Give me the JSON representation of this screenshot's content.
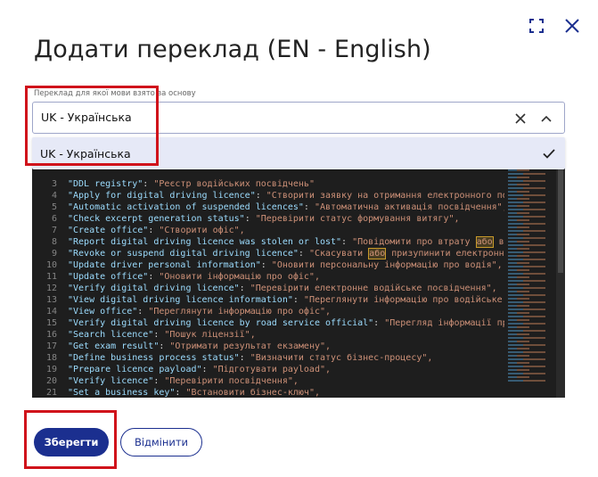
{
  "dialog": {
    "title": "Додати переклад (EN - English)"
  },
  "source_field": {
    "label": "Переклад для якої мови взято за основу",
    "value": "UK - Українська",
    "options": [
      {
        "label": "UK - Українська",
        "selected": true
      }
    ]
  },
  "editor": {
    "lines": [
      {
        "n": "3",
        "key": "\"DDL registry\"",
        "val": "\"Реєстр водійських посвідчень\"",
        "hl": false
      },
      {
        "n": "4",
        "key": "\"Apply for digital driving licence\"",
        "val": "\"Створити заявку на отримання електронного посві",
        "hl": false
      },
      {
        "n": "5",
        "key": "\"Automatic activation of suspended licences\"",
        "val": "\"Автоматична активація посвідчення\",",
        "hl": false
      },
      {
        "n": "6",
        "key": "\"Check excerpt generation status\"",
        "val": "\"Перевірити статус формування витягу\",",
        "hl": false
      },
      {
        "n": "7",
        "key": "\"Create office\"",
        "val": "\"Створити офіс\",",
        "hl": false
      },
      {
        "n": "8",
        "key": "\"Report digital driving licence was stolen or lost\"",
        "val_pre": "\"Повідомити про втрату ",
        "val_hl": "або",
        "val_post": " викра",
        "hl": true
      },
      {
        "n": "9",
        "key": "\"Revoke or suspend digital driving licence\"",
        "val_pre": "\"Скасувати ",
        "val_hl": "або",
        "val_post": " призупинити електронне вод",
        "hl": true
      },
      {
        "n": "10",
        "key": "\"Update driver personal information\"",
        "val": "\"Оновити персональну інформацію про водія\",",
        "hl": false
      },
      {
        "n": "11",
        "key": "\"Update office\"",
        "val": "\"Оновити інформацію про офіс\",",
        "hl": false
      },
      {
        "n": "12",
        "key": "\"Verify digital driving licence\"",
        "val": "\"Перевірити електронне водійське посвідчення\",",
        "hl": false
      },
      {
        "n": "13",
        "key": "\"View digital driving licence information\"",
        "val": "\"Переглянути інформацію про водійське посв",
        "hl": false
      },
      {
        "n": "14",
        "key": "\"View office\"",
        "val": "\"Переглянути інформацію про офіс\",",
        "hl": false
      },
      {
        "n": "15",
        "key": "\"Verify digital driving licence by road service official\"",
        "val": "\"Перегляд інформації про в",
        "hl": false
      },
      {
        "n": "16",
        "key": "\"Search licence\"",
        "val": "\"Пошук ліцензії\",",
        "hl": false
      },
      {
        "n": "17",
        "key": "\"Get exam result\"",
        "val": "\"Отримати результат екзамену\",",
        "hl": false
      },
      {
        "n": "18",
        "key": "\"Define business process status\"",
        "val": "\"Визначити статус бізнес-процесу\",",
        "hl": false
      },
      {
        "n": "19",
        "key": "\"Prepare licence payload\"",
        "val": "\"Підготувати payload\",",
        "hl": false
      },
      {
        "n": "20",
        "key": "\"Verify licence\"",
        "val": "\"Перевірити посвідчення\",",
        "hl": false
      },
      {
        "n": "21",
        "key": "\"Set a business key\"",
        "val": "\"Встановити бізнес-ключ\",",
        "hl": false
      }
    ]
  },
  "buttons": {
    "save_label": "Зберегти",
    "cancel_label": "Відмінити"
  },
  "icons": {
    "expand": "expand-icon",
    "close": "close-icon",
    "clear": "clear-icon",
    "chevron": "chevron-up-icon",
    "check": "check-icon"
  },
  "colors": {
    "primary": "#1b2f8f",
    "highlight_annotation": "#d0131b",
    "dropdown_option_bg": "#e6e9f7",
    "editor_bg": "#1e1e1e"
  }
}
